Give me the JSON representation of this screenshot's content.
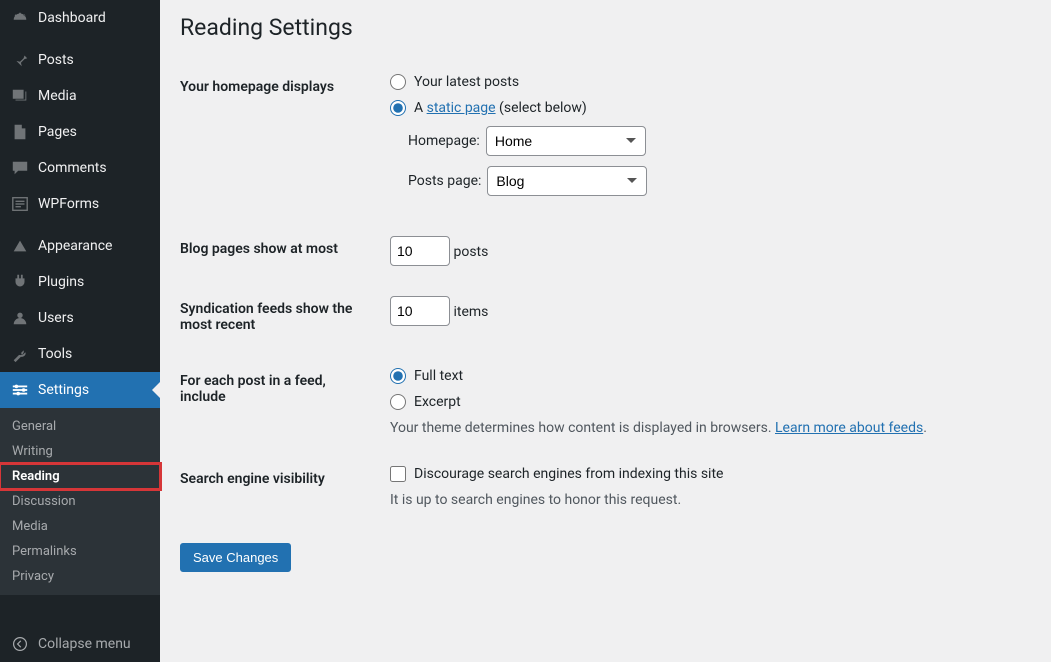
{
  "sidebar": {
    "items": [
      {
        "label": "Dashboard"
      },
      {
        "label": "Posts"
      },
      {
        "label": "Media"
      },
      {
        "label": "Pages"
      },
      {
        "label": "Comments"
      },
      {
        "label": "WPForms"
      },
      {
        "label": "Appearance"
      },
      {
        "label": "Plugins"
      },
      {
        "label": "Users"
      },
      {
        "label": "Tools"
      },
      {
        "label": "Settings"
      }
    ],
    "submenu": [
      {
        "label": "General"
      },
      {
        "label": "Writing"
      },
      {
        "label": "Reading"
      },
      {
        "label": "Discussion"
      },
      {
        "label": "Media"
      },
      {
        "label": "Permalinks"
      },
      {
        "label": "Privacy"
      }
    ],
    "collapse_label": "Collapse menu"
  },
  "page": {
    "title": "Reading Settings",
    "homepage_displays": {
      "label": "Your homepage displays",
      "option_latest": "Your latest posts",
      "option_static_prefix": "A ",
      "option_static_link": "static page",
      "option_static_suffix": " (select below)",
      "homepage_label": "Homepage:",
      "homepage_value": "Home",
      "posts_page_label": "Posts page:",
      "posts_page_value": "Blog"
    },
    "blog_pages": {
      "label": "Blog pages show at most",
      "value": "10",
      "suffix": "posts"
    },
    "syndication": {
      "label": "Syndication feeds show the most recent",
      "value": "10",
      "suffix": "items"
    },
    "feed_include": {
      "label": "For each post in a feed, include",
      "option_full": "Full text",
      "option_excerpt": "Excerpt",
      "desc_prefix": "Your theme determines how content is displayed in browsers. ",
      "desc_link": "Learn more about feeds",
      "desc_suffix": "."
    },
    "search_visibility": {
      "label": "Search engine visibility",
      "checkbox_label": "Discourage search engines from indexing this site",
      "desc": "It is up to search engines to honor this request."
    },
    "save_button": "Save Changes"
  }
}
